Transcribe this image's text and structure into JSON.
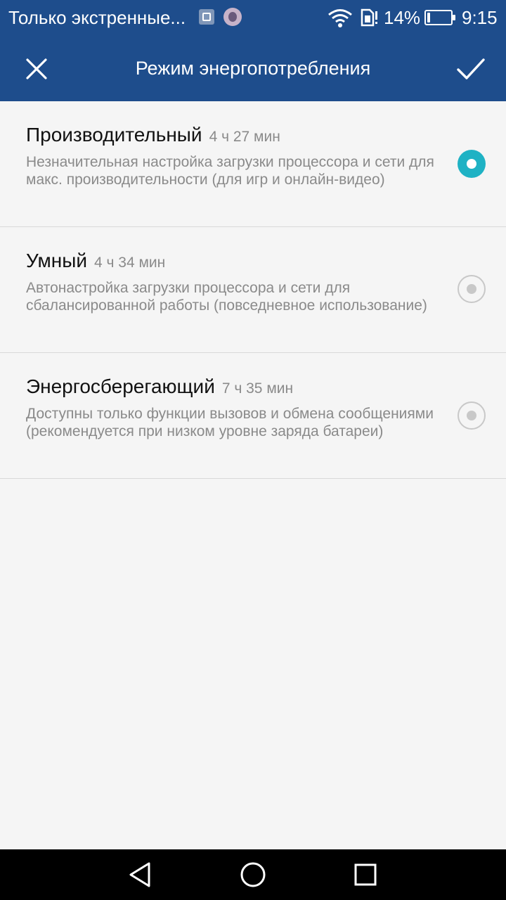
{
  "status_bar": {
    "notification_text": "Только экстренные...",
    "battery_percent_text": "14%",
    "battery_level": 0.14,
    "time": "9:15",
    "icons": [
      "image-icon",
      "avatar-icon",
      "wifi-icon",
      "sim-icon",
      "battery-icon"
    ]
  },
  "toolbar": {
    "title": "Режим энергопотребления",
    "close_icon": "close-icon",
    "confirm_icon": "check-icon"
  },
  "modes": [
    {
      "title": "Производительный",
      "time": "4 ч 27 мин",
      "description": "Незначительная настройка загрузки процессора и сети для макс. производительности (для игр и онлайн-видео)",
      "selected": true
    },
    {
      "title": "Умный",
      "time": "4 ч 34 мин",
      "description": "Автонастройка загрузки процессора и сети для сбалансированной работы (повседневное использование)",
      "selected": false
    },
    {
      "title": "Энергосберегающий",
      "time": "7 ч 35 мин",
      "description": "Доступны только функции вызовов и обмена сообщениями (рекомендуется при низком уровне заряда батареи)",
      "selected": false
    }
  ],
  "colors": {
    "header_bg": "#1e4d8c",
    "accent": "#1fb2c4",
    "background": "#f5f5f5"
  },
  "nav_bar": [
    "back-icon",
    "home-icon",
    "recents-icon"
  ]
}
